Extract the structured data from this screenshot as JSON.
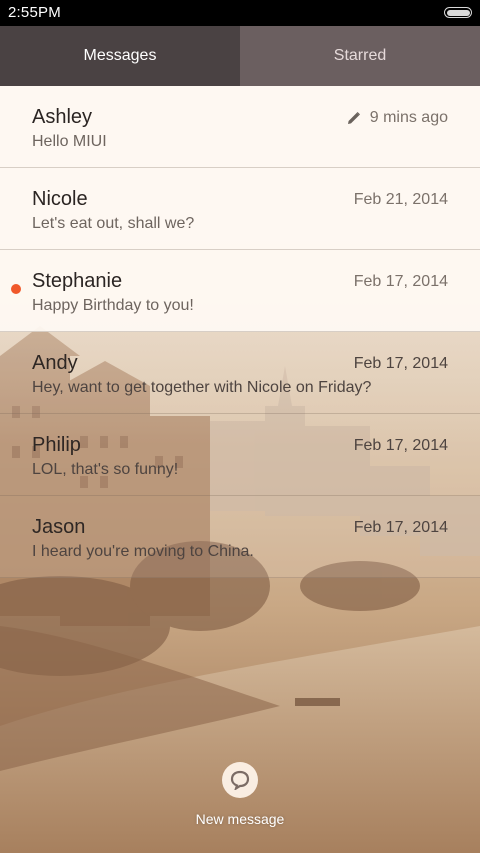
{
  "status_bar": {
    "time": "2:55PM"
  },
  "tabs": [
    {
      "label": "Messages",
      "active": true
    },
    {
      "label": "Starred",
      "active": false
    }
  ],
  "messages": [
    {
      "name": "Ashley",
      "snippet": "Hello MIUI",
      "date": "9 mins ago",
      "draft": true,
      "unread": false
    },
    {
      "name": "Nicole",
      "snippet": "Let's eat out, shall we?",
      "date": "Feb 21, 2014",
      "draft": false,
      "unread": false
    },
    {
      "name": "Stephanie",
      "snippet": "Happy Birthday to you!",
      "date": "Feb 17, 2014",
      "draft": false,
      "unread": true
    },
    {
      "name": "Andy",
      "snippet": "Hey, want to get together with Nicole on Friday?",
      "date": "Feb 17, 2014",
      "draft": false,
      "unread": false
    },
    {
      "name": "Philip",
      "snippet": "LOL, that's so funny!",
      "date": "Feb 17, 2014",
      "draft": false,
      "unread": false
    },
    {
      "name": "Jason",
      "snippet": "I heard you're moving to China.",
      "date": "Feb 17, 2014",
      "draft": false,
      "unread": false
    }
  ],
  "new_message": {
    "label": "New message",
    "icon": "chat-bubble-icon"
  },
  "colors": {
    "active_tab": "#4a4243",
    "inactive_tab": "#6b5f60",
    "unread_dot": "#f0582a"
  }
}
